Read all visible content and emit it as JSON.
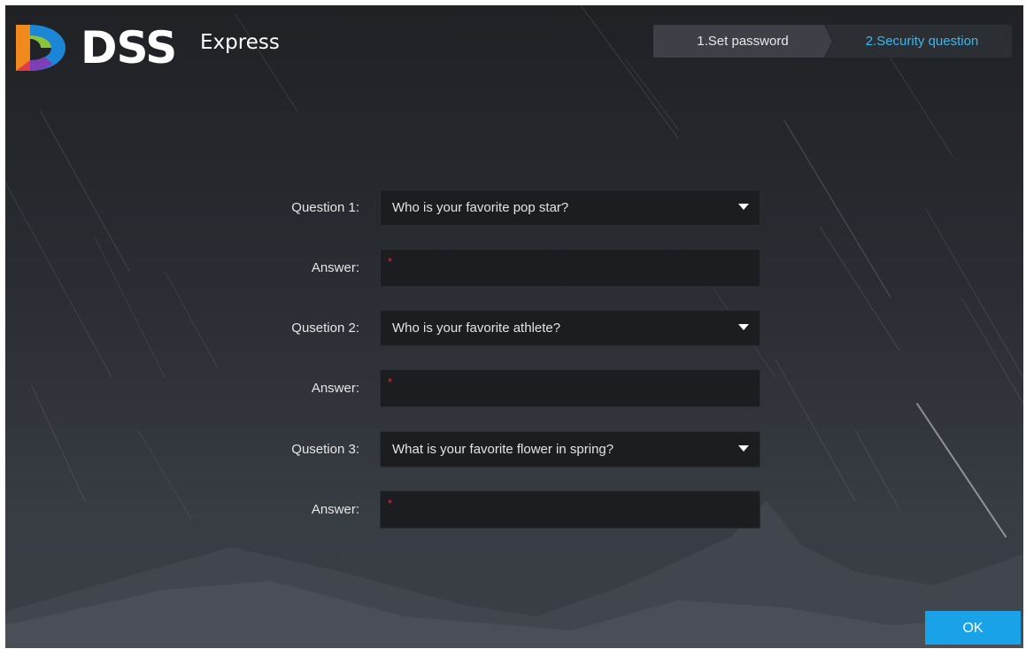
{
  "app": {
    "logo_main": "DSS",
    "logo_sub": "Express"
  },
  "steps": [
    {
      "label": "1.Set password",
      "active": false
    },
    {
      "label": "2.Security question",
      "active": true
    }
  ],
  "form": {
    "rows": [
      {
        "question_label": "Question 1:",
        "question_value": "Who is your favorite pop star?",
        "answer_label": "Answer:",
        "answer_value": ""
      },
      {
        "question_label": "Qusetion 2:",
        "question_value": "Who is your favorite athlete?",
        "answer_label": "Answer:",
        "answer_value": ""
      },
      {
        "question_label": "Qusetion 3:",
        "question_value": "What is your favorite flower in spring?",
        "answer_label": "Answer:",
        "answer_value": ""
      }
    ],
    "required_mark": "*"
  },
  "actions": {
    "ok_label": "OK"
  },
  "colors": {
    "accent": "#1aa2e9",
    "active_step_text": "#3eb7ec",
    "required": "#e8262a",
    "field_bg": "#1c1d21"
  },
  "icons": {
    "logo": "dss-logo-icon",
    "dropdown": "caret-down-icon"
  }
}
